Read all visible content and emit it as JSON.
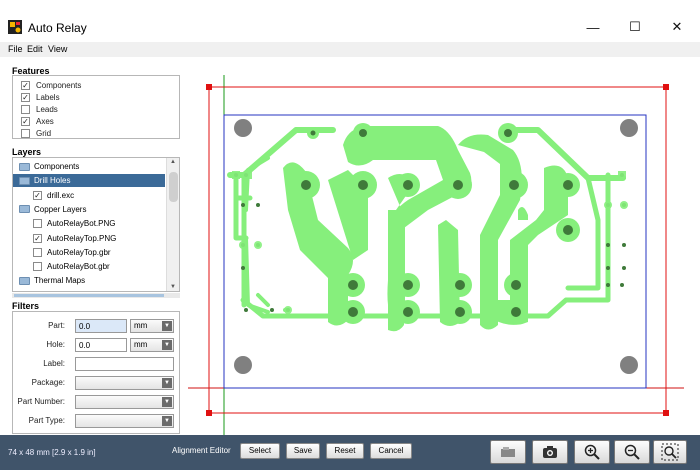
{
  "window": {
    "title": "Auto Relay",
    "minimize": "—",
    "maximize": "☐",
    "close": "✕"
  },
  "menu": [
    "File",
    "Edit",
    "View"
  ],
  "features": {
    "heading": "Features",
    "items": [
      {
        "label": "Components",
        "checked": true
      },
      {
        "label": "Labels",
        "checked": true
      },
      {
        "label": "Leads",
        "checked": false
      },
      {
        "label": "Axes",
        "checked": true
      },
      {
        "label": "Grid",
        "checked": false
      }
    ]
  },
  "layers": {
    "heading": "Layers",
    "items": [
      {
        "label": "Components",
        "type": "folder",
        "indent": 0,
        "selected": false
      },
      {
        "label": "Drill Holes",
        "type": "folder",
        "indent": 0,
        "selected": true
      },
      {
        "label": "drill.exc",
        "type": "check",
        "checked": true,
        "indent": 1,
        "selected": false
      },
      {
        "label": "Copper Layers",
        "type": "folder",
        "indent": 0,
        "selected": false
      },
      {
        "label": "AutoRelayBot.PNG",
        "type": "check",
        "checked": false,
        "indent": 1,
        "selected": false
      },
      {
        "label": "AutoRelayTop.PNG",
        "type": "check",
        "checked": true,
        "indent": 1,
        "selected": false
      },
      {
        "label": "AutoRelayTop.gbr",
        "type": "check",
        "checked": false,
        "indent": 1,
        "selected": false
      },
      {
        "label": "AutoRelayBot.gbr",
        "type": "check",
        "checked": false,
        "indent": 1,
        "selected": false
      },
      {
        "label": "Thermal Maps",
        "type": "folder",
        "indent": 0,
        "selected": false
      }
    ]
  },
  "filters": {
    "heading": "Filters",
    "part_label": "Part:",
    "part_value": "0.0",
    "part_unit": "mm",
    "hole_label": "Hole:",
    "hole_value": "0.0",
    "hole_unit": "mm",
    "label_label": "Label:",
    "label_value": "",
    "package_label": "Package:",
    "part_number_label": "Part Number:",
    "part_type_label": "Part Type:"
  },
  "status": {
    "dimensions": "74 x 48 mm  [2.9 x 1.9 in]",
    "alignment_editor": "Alignment Editor",
    "select": "Select",
    "save": "Save",
    "reset": "Reset",
    "cancel": "Cancel"
  },
  "tools": [
    "layers-icon",
    "camera-icon",
    "zoom-in-icon",
    "zoom-out-icon",
    "zoom-fit-icon"
  ],
  "colors": {
    "copper": "#86ef7c",
    "drill": "#3f7a3a",
    "mount_hole": "#808080",
    "board_outline": "#2433c0",
    "alignment_rect": "#e01010",
    "axis_h": "#d01010",
    "axis_v": "#1a9a1a",
    "statusbar": "#40546a",
    "selection": "#3b6a98"
  }
}
